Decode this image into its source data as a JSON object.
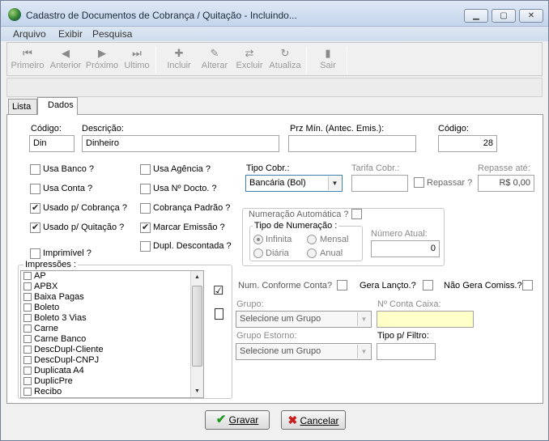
{
  "window": {
    "title": "Cadastro de Documentos de Cobrança / Quitação - Incluindo..."
  },
  "menu": [
    "Arquivo",
    "Exibir",
    "Pesquisa"
  ],
  "toolbar": {
    "primeiro": "Primeiro",
    "anterior": "Anterior",
    "proximo": "Próximo",
    "ultimo": "Ultimo",
    "incluir": "Incluir",
    "alterar": "Alterar",
    "excluir": "Excluir",
    "atualiza": "Atualiza",
    "sair": "Sair"
  },
  "tabs": {
    "lista": "Lista",
    "dados": "Dados"
  },
  "form": {
    "codigo_label": "Código:",
    "codigo_value": "Din",
    "descricao_label": "Descrição:",
    "descricao_value": "Dinheiro",
    "prz_label": "Prz Mín. (Antec. Emis.):",
    "prz_value": "",
    "codigo2_label": "Código:",
    "codigo2_value": "28",
    "usa_banco": "Usa Banco ?",
    "usa_conta": "Usa Conta ?",
    "usado_cobranca": "Usado p/ Cobrança ?",
    "usado_quitacao": "Usado p/ Quitação ?",
    "imprimivel": "Imprimível ?",
    "usa_agencia": "Usa Agência ?",
    "usa_ndocto": "Usa Nº Docto. ?",
    "cobranca_padrao": "Cobrança Padrão ?",
    "marcar_emissao": "Marcar Emissão ?",
    "dupl_descontada": "Dupl. Descontada ?",
    "tipo_cobr_label": "Tipo Cobr.:",
    "tipo_cobr_value": "Bancária (Bol)",
    "tarifa_label": "Tarifa Cobr.:",
    "tarifa_value": "",
    "repassar": "Repassar ?",
    "repasse_label": "Repasse até:",
    "repasse_value": "R$ 0,00",
    "numeracao_auto": "Numeração Automática ?",
    "tipo_numeracao": "Tipo de Numeração :",
    "infinita": "Infinita",
    "mensal": "Mensal",
    "diaria": "Diária",
    "anual": "Anual",
    "numero_atual_label": "Número Atual:",
    "numero_atual_value": "0",
    "impressoes_label": "Impressões :",
    "num_conforme": "Num. Conforme Conta?",
    "gera_lancto": "Gera Lançto.?",
    "nao_gera_comiss": "Não Gera Comiss.?",
    "grupo_label": "Grupo:",
    "grupo_value": "Selecione um Grupo",
    "conta_caixa_label": "Nº Conta Caixa:",
    "conta_caixa_value": "",
    "grupo_estorno_label": "Grupo Estorno:",
    "grupo_estorno_value": "Selecione um Grupo",
    "tipo_filtro_label": "Tipo p/ Filtro:",
    "tipo_filtro_value": ""
  },
  "impressoes": [
    "AP",
    "APBX",
    "Baixa Pagas",
    "Boleto",
    "Boleto 3 Vias",
    "Carne",
    "Carne Banco",
    "DescDupl-Cliente",
    "DescDupl-CNPJ",
    "Duplicata A4",
    "DuplicPre",
    "Recibo"
  ],
  "buttons": {
    "gravar": "Gravar",
    "cancelar": "Cancelar"
  }
}
